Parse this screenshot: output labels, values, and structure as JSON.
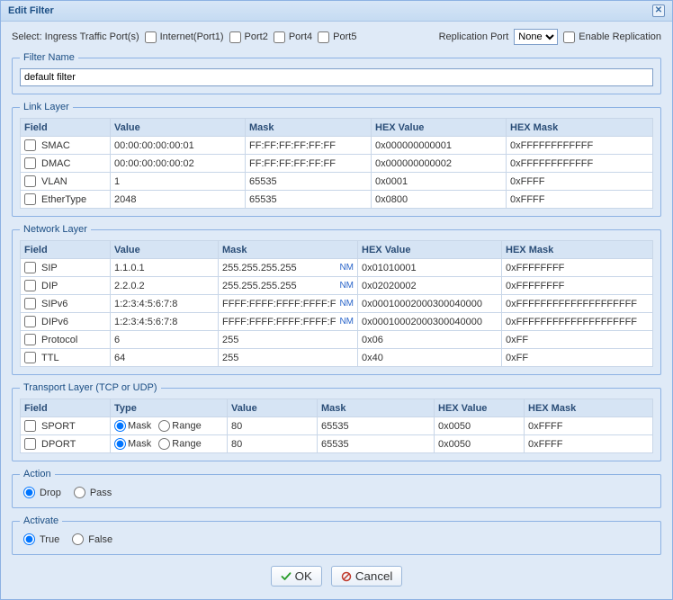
{
  "title": "Edit Filter",
  "ingress": {
    "label": "Select: Ingress Traffic Port(s)",
    "ports": [
      {
        "label": "Internet(Port1)",
        "checked": false
      },
      {
        "label": "Port2",
        "checked": false
      },
      {
        "label": "Port4",
        "checked": false
      },
      {
        "label": "Port5",
        "checked": false
      }
    ]
  },
  "replication": {
    "label": "Replication Port",
    "selected": "None",
    "enable_label": "Enable Replication",
    "enable_checked": false
  },
  "filter_name": {
    "legend": "Filter Name",
    "value": "default filter"
  },
  "columns": {
    "field": "Field",
    "value": "Value",
    "mask": "Mask",
    "hexvalue": "HEX Value",
    "hexmask": "HEX Mask",
    "type": "Type"
  },
  "link_layer": {
    "legend": "Link Layer",
    "rows": [
      {
        "field": "SMAC",
        "checked": false,
        "value": "00:00:00:00:00:01",
        "mask": "FF:FF:FF:FF:FF:FF",
        "hexvalue": "0x000000000001",
        "hexmask": "0xFFFFFFFFFFFF"
      },
      {
        "field": "DMAC",
        "checked": false,
        "value": "00:00:00:00:00:02",
        "mask": "FF:FF:FF:FF:FF:FF",
        "hexvalue": "0x000000000002",
        "hexmask": "0xFFFFFFFFFFFF"
      },
      {
        "field": "VLAN",
        "checked": false,
        "value": "1",
        "mask": "65535",
        "hexvalue": "0x0001",
        "hexmask": "0xFFFF"
      },
      {
        "field": "EtherType",
        "checked": false,
        "value": "2048",
        "mask": "65535",
        "hexvalue": "0x0800",
        "hexmask": "0xFFFF"
      }
    ]
  },
  "network_layer": {
    "legend": "Network Layer",
    "nm_label": "NM",
    "rows": [
      {
        "field": "SIP",
        "checked": false,
        "value": "1.1.0.1",
        "mask": "255.255.255.255",
        "nm": true,
        "hexvalue": "0x01010001",
        "hexmask": "0xFFFFFFFF"
      },
      {
        "field": "DIP",
        "checked": false,
        "value": "2.2.0.2",
        "mask": "255.255.255.255",
        "nm": true,
        "hexvalue": "0x02020002",
        "hexmask": "0xFFFFFFFF"
      },
      {
        "field": "SIPv6",
        "checked": false,
        "value": "1:2:3:4:5:6:7:8",
        "mask": "FFFF:FFFF:FFFF:FFFF:F",
        "nm": true,
        "hexvalue": "0x00010002000300040000",
        "hexmask": "0xFFFFFFFFFFFFFFFFFFFF"
      },
      {
        "field": "DIPv6",
        "checked": false,
        "value": "1:2:3:4:5:6:7:8",
        "mask": "FFFF:FFFF:FFFF:FFFF:F",
        "nm": true,
        "hexvalue": "0x00010002000300040000",
        "hexmask": "0xFFFFFFFFFFFFFFFFFFFF"
      },
      {
        "field": "Protocol",
        "checked": false,
        "value": "6",
        "mask": "255",
        "nm": false,
        "hexvalue": "0x06",
        "hexmask": "0xFF"
      },
      {
        "field": "TTL",
        "checked": false,
        "value": "64",
        "mask": "255",
        "nm": false,
        "hexvalue": "0x40",
        "hexmask": "0xFF"
      }
    ]
  },
  "transport_layer": {
    "legend": "Transport Layer (TCP or UDP)",
    "type_options": {
      "mask": "Mask",
      "range": "Range"
    },
    "rows": [
      {
        "field": "SPORT",
        "checked": false,
        "type": "mask",
        "value": "80",
        "mask": "65535",
        "hexvalue": "0x0050",
        "hexmask": "0xFFFF"
      },
      {
        "field": "DPORT",
        "checked": false,
        "type": "mask",
        "value": "80",
        "mask": "65535",
        "hexvalue": "0x0050",
        "hexmask": "0xFFFF"
      }
    ]
  },
  "action": {
    "legend": "Action",
    "options": {
      "drop": "Drop",
      "pass": "Pass"
    },
    "selected": "drop"
  },
  "activate": {
    "legend": "Activate",
    "options": {
      "true": "True",
      "false": "False"
    },
    "selected": "true"
  },
  "buttons": {
    "ok": "OK",
    "cancel": "Cancel"
  }
}
